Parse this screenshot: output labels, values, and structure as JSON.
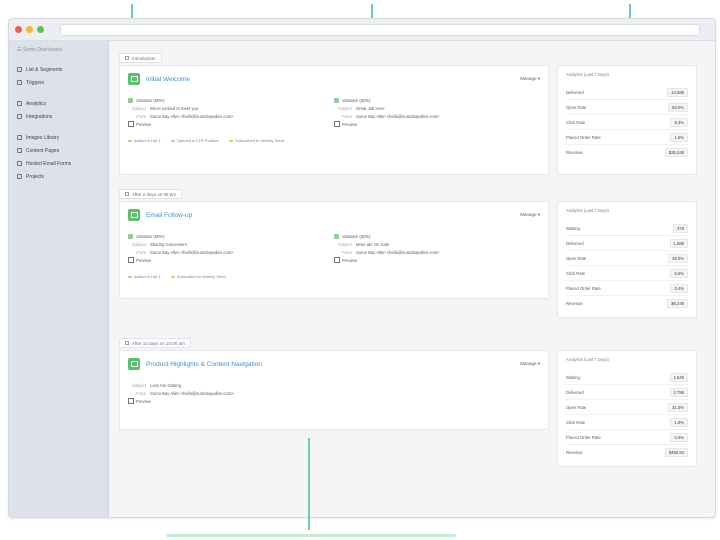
{
  "sidebar": {
    "brand": "☰ Sumo Dashboard",
    "items": [
      {
        "label": "List & Segments"
      },
      {
        "label": "Triggers"
      },
      {
        "label": "Analytics"
      },
      {
        "label": "Integrations"
      },
      {
        "label": "Images Library"
      },
      {
        "label": "Content Pages"
      },
      {
        "label": "Hosted Email Forms"
      },
      {
        "label": "Projects"
      }
    ]
  },
  "sections": [
    {
      "tag": "Introduction",
      "campaign": {
        "title": "Initial Welcome",
        "manage_label": "Manage ▾",
        "variants": [
          {
            "name": "Variation (50%)",
            "subject_label": "Subject",
            "subject": "We're excited to meet you",
            "from_label": "From",
            "from": "Sumo Bay Allen <hello@sumobayallen.com>",
            "preview": "Preview"
          },
          {
            "name": "Variation (50%)",
            "subject_label": "Subject",
            "subject": "Great Job Here",
            "from_label": "From",
            "from": "Sumo Bay Allen <hello@sumobayallen.com>",
            "preview": "Preview"
          }
        ],
        "triggers": [
          {
            "label": "Added to List 1",
            "kind": "ok"
          },
          {
            "label": "Opened a CTR Position",
            "kind": "ok"
          },
          {
            "label": "Subscribed to Weekly Send",
            "kind": "warn"
          }
        ]
      },
      "stats": {
        "title": "Analytics (Last 7 Days)",
        "rows": [
          {
            "label": "Delivered",
            "value": "14,586"
          },
          {
            "label": "Open Rate",
            "value": "60.0%"
          },
          {
            "label": "Click Rate",
            "value": "8.4%"
          },
          {
            "label": "Placed Order Rate",
            "value": "1.6%"
          },
          {
            "label": "Revenue",
            "value": "$35,248"
          }
        ]
      }
    },
    {
      "tag": "After 2 days on 09 pm",
      "campaign": {
        "title": "Email Follow-up",
        "manage_label": "Manage ▾",
        "variants": [
          {
            "name": "Variation (50%)",
            "subject_label": "Subject",
            "subject": "Sharing Convenient",
            "from_label": "From",
            "from": "Sumo Bay Allen <hello@sumobayallen.com>",
            "preview": "Preview"
          },
          {
            "name": "Variation (50%)",
            "subject_label": "Subject",
            "subject": "More are On Sale",
            "from_label": "From",
            "from": "Sumo Bay Allen <hello@sumobayallen.com>",
            "preview": "Preview"
          }
        ],
        "triggers": [
          {
            "label": "Added to List 1",
            "kind": "ok"
          },
          {
            "label": "Subscribed to Weekly Send",
            "kind": "warn"
          }
        ]
      },
      "stats": {
        "title": "Analytics (Last 7 Days)",
        "rows": [
          {
            "label": "Waiting",
            "value": "378"
          },
          {
            "label": "Delivered",
            "value": "1,986"
          },
          {
            "label": "Open Rate",
            "value": "38.9%"
          },
          {
            "label": "Click Rate",
            "value": "5.6%"
          },
          {
            "label": "Placed Order Rate",
            "value": "0.4%"
          },
          {
            "label": "Revenue",
            "value": "$6,348"
          }
        ]
      }
    },
    {
      "tag": "After 10 days on 10:00 am",
      "campaign": {
        "title": "Product Highlights & Content Navigation",
        "manage_label": "Manage ▾",
        "variants": [
          {
            "name": "",
            "subject_label": "Subject",
            "subject": "Less Are Getting",
            "from_label": "From",
            "from": "Sumo Bay Allen <hello@sumobayallen.com>",
            "preview": "Preview"
          }
        ],
        "triggers": []
      },
      "stats": {
        "title": "Analytics (Last 7 Days)",
        "rows": [
          {
            "label": "Waiting",
            "value": "1,549"
          },
          {
            "label": "Delivered",
            "value": "2,796"
          },
          {
            "label": "Open Rate",
            "value": "31.5%"
          },
          {
            "label": "Click Rate",
            "value": "1.9%"
          },
          {
            "label": "Placed Order Rate",
            "value": "0.5%"
          },
          {
            "label": "Revenue",
            "value": "$496.63"
          }
        ]
      }
    }
  ]
}
